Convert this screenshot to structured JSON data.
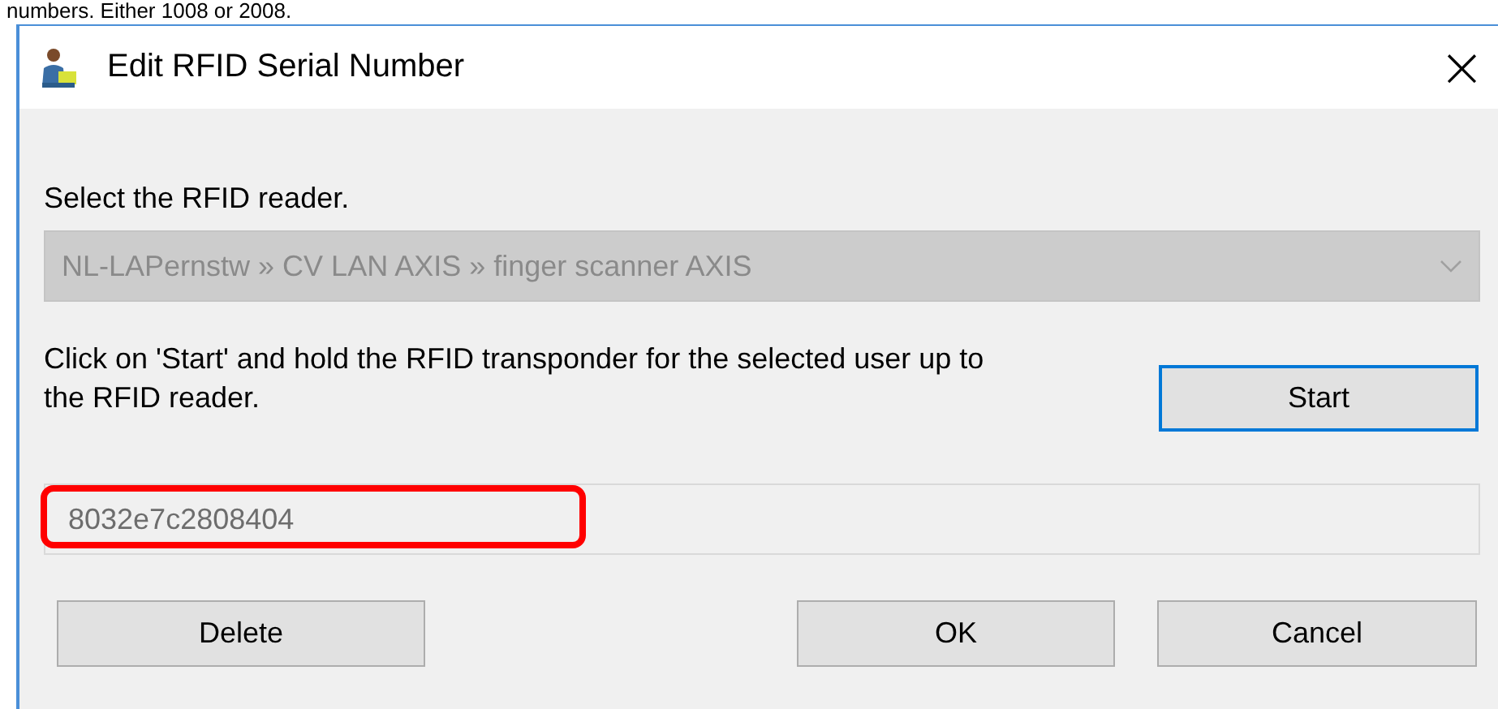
{
  "caption": "numbers. Either 1008 or 2008.",
  "window": {
    "title": "Edit RFID Serial Number",
    "close": "×"
  },
  "reader_label": "Select the RFID reader.",
  "reader_select": {
    "value": "NL-LAPernstw » CV LAN AXIS » finger scanner AXIS",
    "disabled": true
  },
  "instruction": "Click on 'Start' and hold the RFID transponder for the selected user up to the RFID reader.",
  "start_button": {
    "label": "Start",
    "focused": true
  },
  "serial_field": {
    "value": "8032e7c2808404",
    "disabled": true,
    "highlighted": true
  },
  "buttons": [
    {
      "label": "Delete"
    },
    {
      "label": "OK"
    },
    {
      "label": "Cancel"
    }
  ]
}
